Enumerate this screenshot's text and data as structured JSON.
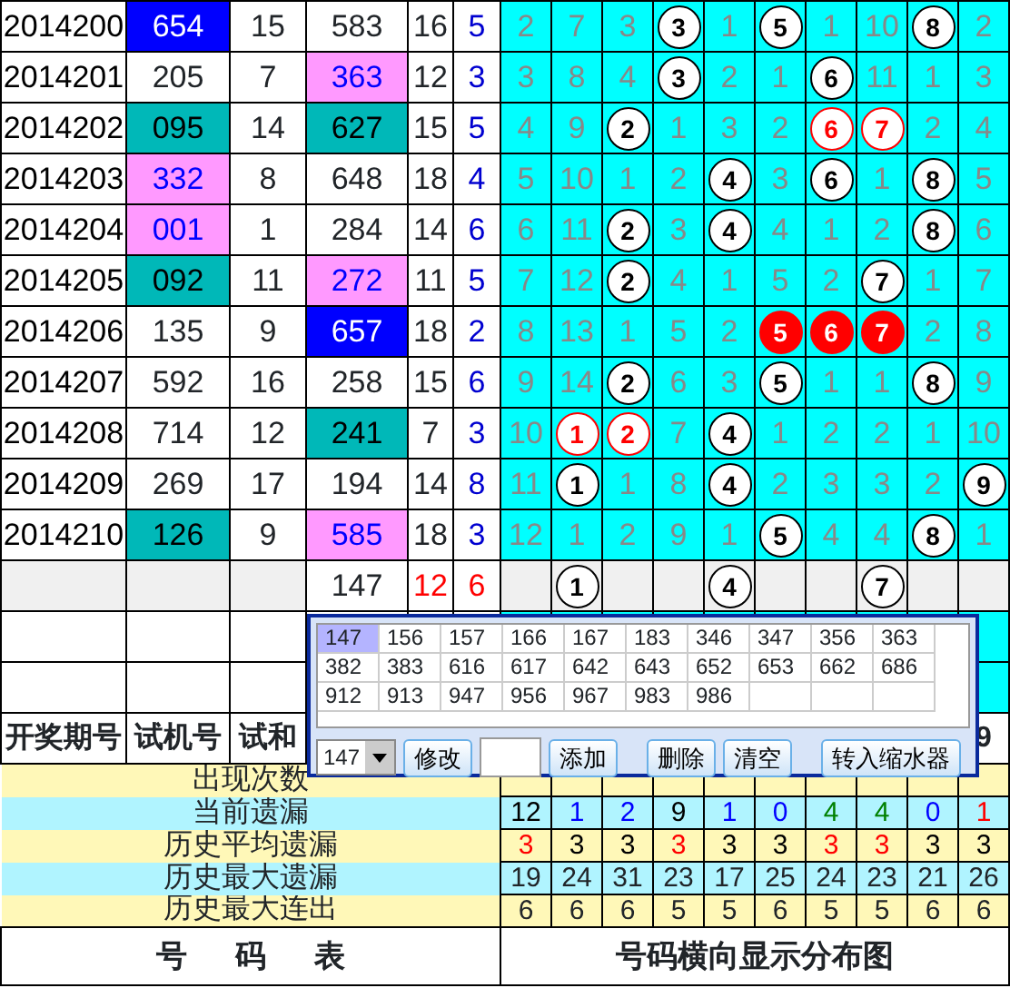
{
  "rows": [
    {
      "period": "2014200",
      "test": {
        "text": "654",
        "color": "#0000ff"
      },
      "sum": "15",
      "draw": {
        "text": "583"
      },
      "draw_sum": "16",
      "span": "5",
      "cells": [
        {
          "kind": "miss",
          "text": "2"
        },
        {
          "kind": "miss",
          "text": "7"
        },
        {
          "kind": "miss",
          "text": "3"
        },
        {
          "kind": "ball",
          "text": "3"
        },
        {
          "kind": "miss",
          "text": "1"
        },
        {
          "kind": "ball",
          "text": "5"
        },
        {
          "kind": "miss",
          "text": "1"
        },
        {
          "kind": "miss",
          "text": "10"
        },
        {
          "kind": "ball",
          "text": "8"
        },
        {
          "kind": "miss",
          "text": "2"
        }
      ]
    },
    {
      "period": "2014201",
      "test": {
        "text": "205"
      },
      "sum": "7",
      "draw": {
        "text": "363",
        "color": "#ff99ff"
      },
      "draw_sum": "12",
      "span": "3",
      "cells": [
        {
          "kind": "miss",
          "text": "3"
        },
        {
          "kind": "miss",
          "text": "8"
        },
        {
          "kind": "miss",
          "text": "4"
        },
        {
          "kind": "ball",
          "text": "3"
        },
        {
          "kind": "miss",
          "text": "2"
        },
        {
          "kind": "miss",
          "text": "1"
        },
        {
          "kind": "ball",
          "text": "6"
        },
        {
          "kind": "miss",
          "text": "11"
        },
        {
          "kind": "miss",
          "text": "1"
        },
        {
          "kind": "miss",
          "text": "3"
        }
      ]
    },
    {
      "period": "2014202",
      "test": {
        "text": "095",
        "color": "#00b8b8"
      },
      "sum": "14",
      "draw": {
        "text": "627",
        "color": "#00b8b8"
      },
      "draw_sum": "15",
      "span": "5",
      "cells": [
        {
          "kind": "miss",
          "text": "4"
        },
        {
          "kind": "miss",
          "text": "9"
        },
        {
          "kind": "ball",
          "text": "2"
        },
        {
          "kind": "miss",
          "text": "1"
        },
        {
          "kind": "miss",
          "text": "3"
        },
        {
          "kind": "miss",
          "text": "2"
        },
        {
          "kind": "redring",
          "text": "6"
        },
        {
          "kind": "redring",
          "text": "7"
        },
        {
          "kind": "miss",
          "text": "2"
        },
        {
          "kind": "miss",
          "text": "4"
        }
      ]
    },
    {
      "period": "2014203",
      "test": {
        "text": "332",
        "color": "#ff99ff"
      },
      "sum": "8",
      "draw": {
        "text": "648"
      },
      "draw_sum": "18",
      "span": "4",
      "cells": [
        {
          "kind": "miss",
          "text": "5"
        },
        {
          "kind": "miss",
          "text": "10"
        },
        {
          "kind": "miss",
          "text": "1"
        },
        {
          "kind": "miss",
          "text": "2"
        },
        {
          "kind": "ball",
          "text": "4"
        },
        {
          "kind": "miss",
          "text": "3"
        },
        {
          "kind": "ball",
          "text": "6"
        },
        {
          "kind": "miss",
          "text": "1"
        },
        {
          "kind": "ball",
          "text": "8"
        },
        {
          "kind": "miss",
          "text": "5"
        }
      ]
    },
    {
      "period": "2014204",
      "test": {
        "text": "001",
        "color": "#ff99ff"
      },
      "sum": "1",
      "draw": {
        "text": "284"
      },
      "draw_sum": "14",
      "span": "6",
      "cells": [
        {
          "kind": "miss",
          "text": "6"
        },
        {
          "kind": "miss",
          "text": "11"
        },
        {
          "kind": "ball",
          "text": "2"
        },
        {
          "kind": "miss",
          "text": "3"
        },
        {
          "kind": "ball",
          "text": "4"
        },
        {
          "kind": "miss",
          "text": "4"
        },
        {
          "kind": "miss",
          "text": "1"
        },
        {
          "kind": "miss",
          "text": "2"
        },
        {
          "kind": "ball",
          "text": "8"
        },
        {
          "kind": "miss",
          "text": "6"
        }
      ]
    },
    {
      "period": "2014205",
      "test": {
        "text": "092",
        "color": "#00b8b8"
      },
      "sum": "11",
      "draw": {
        "text": "272",
        "color": "#ff99ff"
      },
      "draw_sum": "11",
      "span": "5",
      "cells": [
        {
          "kind": "miss",
          "text": "7"
        },
        {
          "kind": "miss",
          "text": "12"
        },
        {
          "kind": "ball",
          "text": "2"
        },
        {
          "kind": "miss",
          "text": "4"
        },
        {
          "kind": "miss",
          "text": "1"
        },
        {
          "kind": "miss",
          "text": "5"
        },
        {
          "kind": "miss",
          "text": "2"
        },
        {
          "kind": "ball",
          "text": "7"
        },
        {
          "kind": "miss",
          "text": "1"
        },
        {
          "kind": "miss",
          "text": "7"
        }
      ]
    },
    {
      "period": "2014206",
      "test": {
        "text": "135"
      },
      "sum": "9",
      "draw": {
        "text": "657",
        "color": "#0000ff"
      },
      "draw_sum": "18",
      "span": "2",
      "cells": [
        {
          "kind": "miss",
          "text": "8"
        },
        {
          "kind": "miss",
          "text": "13"
        },
        {
          "kind": "miss",
          "text": "1"
        },
        {
          "kind": "miss",
          "text": "5"
        },
        {
          "kind": "miss",
          "text": "2"
        },
        {
          "kind": "redball",
          "text": "5"
        },
        {
          "kind": "redball",
          "text": "6"
        },
        {
          "kind": "redball",
          "text": "7"
        },
        {
          "kind": "miss",
          "text": "2"
        },
        {
          "kind": "miss",
          "text": "8"
        }
      ]
    },
    {
      "period": "2014207",
      "test": {
        "text": "592"
      },
      "sum": "16",
      "draw": {
        "text": "258"
      },
      "draw_sum": "15",
      "span": "6",
      "cells": [
        {
          "kind": "miss",
          "text": "9"
        },
        {
          "kind": "miss",
          "text": "14"
        },
        {
          "kind": "ball",
          "text": "2"
        },
        {
          "kind": "miss",
          "text": "6"
        },
        {
          "kind": "miss",
          "text": "3"
        },
        {
          "kind": "ball",
          "text": "5"
        },
        {
          "kind": "miss",
          "text": "1"
        },
        {
          "kind": "miss",
          "text": "1"
        },
        {
          "kind": "ball",
          "text": "8"
        },
        {
          "kind": "miss",
          "text": "9"
        }
      ]
    },
    {
      "period": "2014208",
      "test": {
        "text": "714"
      },
      "sum": "12",
      "draw": {
        "text": "241",
        "color": "#00b8b8"
      },
      "draw_sum": "7",
      "span": "3",
      "cells": [
        {
          "kind": "miss",
          "text": "10"
        },
        {
          "kind": "redring",
          "text": "1"
        },
        {
          "kind": "redring",
          "text": "2"
        },
        {
          "kind": "miss",
          "text": "7"
        },
        {
          "kind": "ball",
          "text": "4"
        },
        {
          "kind": "miss",
          "text": "1"
        },
        {
          "kind": "miss",
          "text": "2"
        },
        {
          "kind": "miss",
          "text": "2"
        },
        {
          "kind": "miss",
          "text": "1"
        },
        {
          "kind": "miss",
          "text": "10"
        }
      ]
    },
    {
      "period": "2014209",
      "test": {
        "text": "269"
      },
      "sum": "17",
      "draw": {
        "text": "194"
      },
      "draw_sum": "14",
      "span": "8",
      "cells": [
        {
          "kind": "miss",
          "text": "11"
        },
        {
          "kind": "ball",
          "text": "1"
        },
        {
          "kind": "miss",
          "text": "1"
        },
        {
          "kind": "miss",
          "text": "8"
        },
        {
          "kind": "ball",
          "text": "4"
        },
        {
          "kind": "miss",
          "text": "2"
        },
        {
          "kind": "miss",
          "text": "3"
        },
        {
          "kind": "miss",
          "text": "3"
        },
        {
          "kind": "miss",
          "text": "2"
        },
        {
          "kind": "ball",
          "text": "9"
        }
      ]
    },
    {
      "period": "2014210",
      "test": {
        "text": "126",
        "color": "#00b8b8"
      },
      "sum": "9",
      "draw": {
        "text": "585",
        "color": "#ff99ff"
      },
      "draw_sum": "18",
      "span": "3",
      "cells": [
        {
          "kind": "miss",
          "text": "12"
        },
        {
          "kind": "miss",
          "text": "1"
        },
        {
          "kind": "miss",
          "text": "2"
        },
        {
          "kind": "miss",
          "text": "9"
        },
        {
          "kind": "miss",
          "text": "1"
        },
        {
          "kind": "ball",
          "text": "5"
        },
        {
          "kind": "miss",
          "text": "4"
        },
        {
          "kind": "miss",
          "text": "4"
        },
        {
          "kind": "ball",
          "text": "8"
        },
        {
          "kind": "miss",
          "text": "1"
        }
      ]
    }
  ],
  "summary": {
    "draw": "147",
    "draw_sum": "12",
    "span": "6",
    "cells": [
      {
        "kind": "blank"
      },
      {
        "kind": "ball",
        "text": "1"
      },
      {
        "kind": "blank"
      },
      {
        "kind": "blank"
      },
      {
        "kind": "ball",
        "text": "4"
      },
      {
        "kind": "blank"
      },
      {
        "kind": "blank"
      },
      {
        "kind": "ball",
        "text": "7"
      },
      {
        "kind": "blank"
      },
      {
        "kind": "blank"
      }
    ]
  },
  "header": {
    "labels": [
      "开奖期号",
      "试机号",
      "试和"
    ],
    "last_column": "9"
  },
  "stats": [
    {
      "label": "出现次数",
      "color": "#fff8b8"
    },
    {
      "label": "当前遗漏",
      "color": "#b0f4ff",
      "values": [
        {
          "text": "12",
          "color": "#000000"
        },
        {
          "text": "1",
          "color": "#0000ff"
        },
        {
          "text": "2",
          "color": "#0000ff"
        },
        {
          "text": "9",
          "color": "#000000"
        },
        {
          "text": "1",
          "color": "#0000ff"
        },
        {
          "text": "0",
          "color": "#0000ff"
        },
        {
          "text": "4",
          "color": "#008000"
        },
        {
          "text": "4",
          "color": "#008000"
        },
        {
          "text": "0",
          "color": "#0000ff"
        },
        {
          "text": "1",
          "color": "#ff0000"
        }
      ]
    },
    {
      "label": "历史平均遗漏",
      "color": "#fff8b8",
      "values": [
        {
          "text": "3",
          "color": "#ff0000"
        },
        {
          "text": "3",
          "color": "#000000"
        },
        {
          "text": "3",
          "color": "#000000"
        },
        {
          "text": "3",
          "color": "#ff0000"
        },
        {
          "text": "3",
          "color": "#000000"
        },
        {
          "text": "3",
          "color": "#000000"
        },
        {
          "text": "3",
          "color": "#ff0000"
        },
        {
          "text": "3",
          "color": "#ff0000"
        },
        {
          "text": "3",
          "color": "#000000"
        },
        {
          "text": "3",
          "color": "#000000"
        }
      ]
    },
    {
      "label": "历史最大遗漏",
      "color": "#b0f4ff",
      "values": [
        {
          "text": "19"
        },
        {
          "text": "24"
        },
        {
          "text": "31"
        },
        {
          "text": "23"
        },
        {
          "text": "17"
        },
        {
          "text": "25"
        },
        {
          "text": "24"
        },
        {
          "text": "23"
        },
        {
          "text": "21"
        },
        {
          "text": "26"
        }
      ]
    },
    {
      "label": "历史最大连出",
      "color": "#fff8b8",
      "values": [
        {
          "text": "6"
        },
        {
          "text": "6"
        },
        {
          "text": "6"
        },
        {
          "text": "5"
        },
        {
          "text": "5"
        },
        {
          "text": "6"
        },
        {
          "text": "5"
        },
        {
          "text": "5"
        },
        {
          "text": "6"
        },
        {
          "text": "6"
        }
      ]
    }
  ],
  "footer": [
    "号 码 表",
    "号码横向显示分布图"
  ],
  "picker": {
    "numbers": [
      {
        "text": "147",
        "selected": true
      },
      {
        "text": "156",
        "selected": false
      },
      {
        "text": "157",
        "selected": false
      },
      {
        "text": "166",
        "selected": false
      },
      {
        "text": "167",
        "selected": false
      },
      {
        "text": "183",
        "selected": false
      },
      {
        "text": "346",
        "selected": false
      },
      {
        "text": "347",
        "selected": false
      },
      {
        "text": "356",
        "selected": false
      },
      {
        "text": "363",
        "selected": false
      },
      {
        "text": "382",
        "selected": false
      },
      {
        "text": "383",
        "selected": false
      },
      {
        "text": "616",
        "selected": false
      },
      {
        "text": "617",
        "selected": false
      },
      {
        "text": "642",
        "selected": false
      },
      {
        "text": "643",
        "selected": false
      },
      {
        "text": "652",
        "selected": false
      },
      {
        "text": "653",
        "selected": false
      },
      {
        "text": "662",
        "selected": false
      },
      {
        "text": "686",
        "selected": false
      },
      {
        "text": "912",
        "selected": false
      },
      {
        "text": "913",
        "selected": false
      },
      {
        "text": "947",
        "selected": false
      },
      {
        "text": "956",
        "selected": false
      },
      {
        "text": "967",
        "selected": false
      },
      {
        "text": "983",
        "selected": false
      },
      {
        "text": "986",
        "selected": false
      }
    ],
    "controls": [
      {
        "kind": "select",
        "text": "147"
      },
      {
        "kind": "button",
        "text": "修改"
      },
      {
        "kind": "input"
      },
      {
        "kind": "button",
        "text": "添加"
      },
      {
        "kind": "gap"
      },
      {
        "kind": "button",
        "text": "删除"
      },
      {
        "kind": "button",
        "text": "清空"
      },
      {
        "kind": "gap"
      },
      {
        "kind": "button",
        "text": "转入缩水器"
      }
    ]
  }
}
